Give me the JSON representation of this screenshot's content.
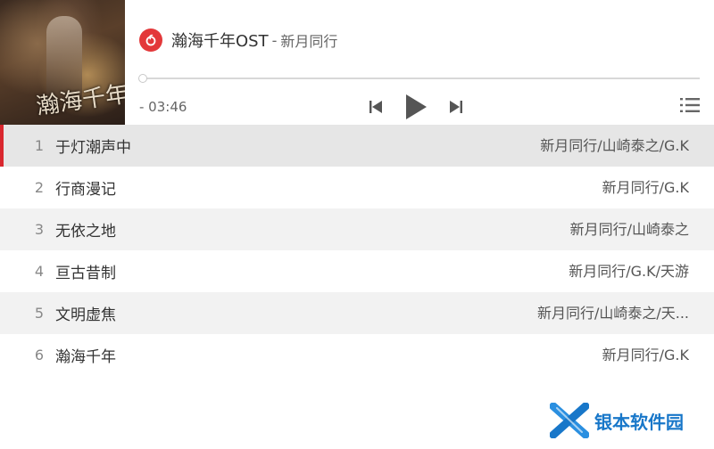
{
  "album_cover": {
    "title_art": "瀚海千年"
  },
  "header": {
    "logo": "netease-cloud-music-icon",
    "track_title": "瀚海千年OST",
    "separator": "-",
    "artist": "新月同行"
  },
  "player": {
    "progress": 0,
    "time_display": "- 03:46",
    "controls": [
      "previous-icon",
      "play-icon",
      "next-icon",
      "playlist-icon"
    ]
  },
  "playlist": [
    {
      "index": "1",
      "title": "于灯潮声中",
      "artist": "新月同行/山崎泰之/G.K",
      "active": true
    },
    {
      "index": "2",
      "title": "行商漫记",
      "artist": "新月同行/G.K",
      "active": false
    },
    {
      "index": "3",
      "title": "无依之地",
      "artist": "新月同行/山崎泰之",
      "active": false
    },
    {
      "index": "4",
      "title": "亘古昔制",
      "artist": "新月同行/G.K/天游",
      "active": false
    },
    {
      "index": "5",
      "title": "文明虚焦",
      "artist": "新月同行/山崎泰之/天...",
      "active": false
    },
    {
      "index": "6",
      "title": "瀚海千年",
      "artist": "新月同行/G.K",
      "active": false
    }
  ],
  "watermark": {
    "text": "银本软件园"
  },
  "colors": {
    "accent": "#d9272e",
    "logo_red": "#e3383a",
    "watermark_blue": "#1877c9"
  }
}
